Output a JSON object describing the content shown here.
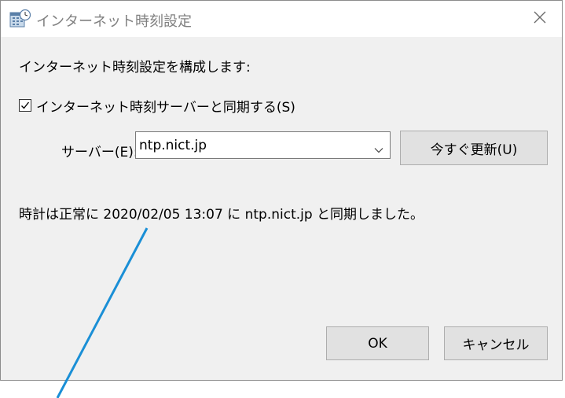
{
  "window": {
    "title": "インターネット時刻設定",
    "close_icon": "close-icon",
    "app_icon": "calendar-clock-icon"
  },
  "form": {
    "configure_label": "インターネット時刻設定を構成します:",
    "sync_checkbox": {
      "label": "インターネット時刻サーバーと同期する(S)",
      "checked": true
    },
    "server_label": "サーバー(E):",
    "server_value": "ntp.nict.jp",
    "update_button": "今すぐ更新(U)",
    "status": "時計は正常に 2020/02/05 13:07 に ntp.nict.jp と同期しました。"
  },
  "buttons": {
    "ok": "OK",
    "cancel": "キャンセル"
  },
  "colors": {
    "dialog_bg": "#f0f0f0",
    "titlebar_bg": "#ffffff",
    "button_bg": "#e1e1e1",
    "callout_line": "#1a8fd6"
  }
}
